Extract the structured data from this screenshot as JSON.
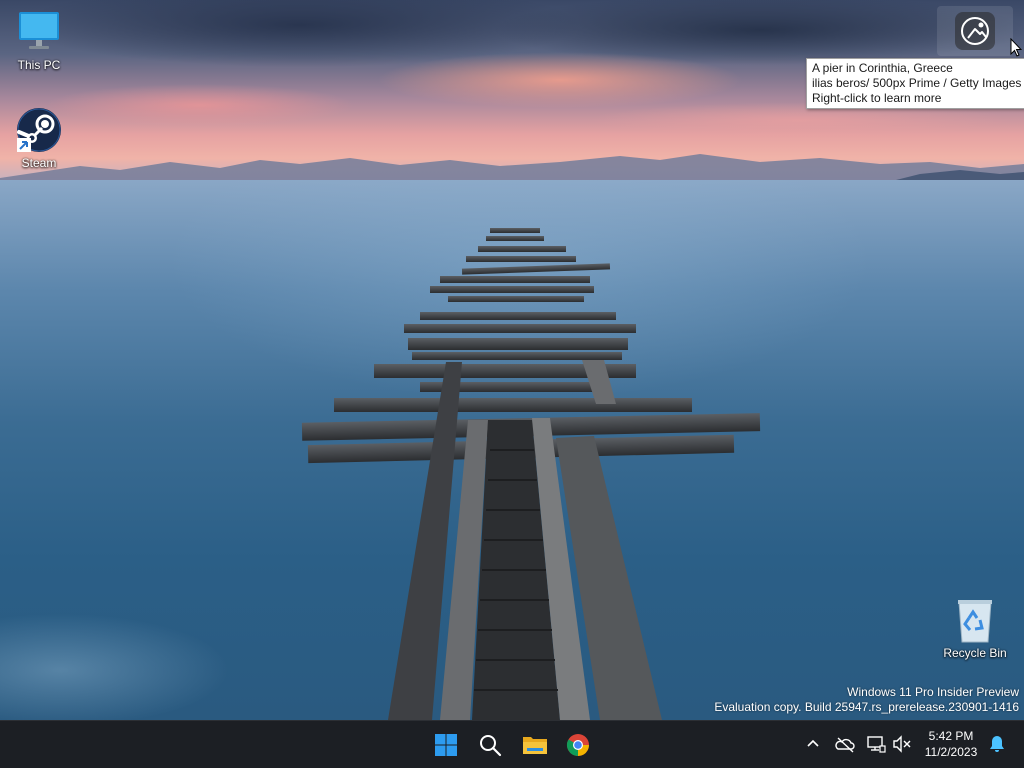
{
  "desktop": {
    "icons": [
      {
        "label": "This PC",
        "icon": "monitor-icon"
      },
      {
        "label": "Steam",
        "icon": "steam-icon"
      },
      {
        "label": "Recycle Bin",
        "icon": "recycle-bin-icon"
      }
    ]
  },
  "spotlight": {
    "icon": "spotlight-icon",
    "tooltip": {
      "line1": "A pier in Corinthia, Greece",
      "line2": "ilias beros/ 500px Prime / Getty Images",
      "line3": "Right-click to learn more"
    }
  },
  "watermark": {
    "line1": "Windows 11 Pro Insider Preview",
    "line2": "Evaluation copy. Build 25947.rs_prerelease.230901-1416"
  },
  "taskbar": {
    "apps": [
      {
        "icon": "windows-start-icon"
      },
      {
        "icon": "search-icon"
      },
      {
        "icon": "file-explorer-icon"
      },
      {
        "icon": "chrome-icon"
      }
    ],
    "tray": [
      {
        "icon": "chevron-up-icon"
      },
      {
        "icon": "onedrive-offline-icon"
      },
      {
        "icon": "network-icon"
      },
      {
        "icon": "volume-muted-icon"
      }
    ],
    "clock": {
      "time": "5:42 PM",
      "date": "11/2/2023"
    },
    "notification_icon": "bell-icon"
  },
  "colors": {
    "taskbar_bg": "#1c1f24",
    "start_blue": "#2d9cf0",
    "folder_yellow": "#f5c33b",
    "steam_dark": "#17294a"
  }
}
